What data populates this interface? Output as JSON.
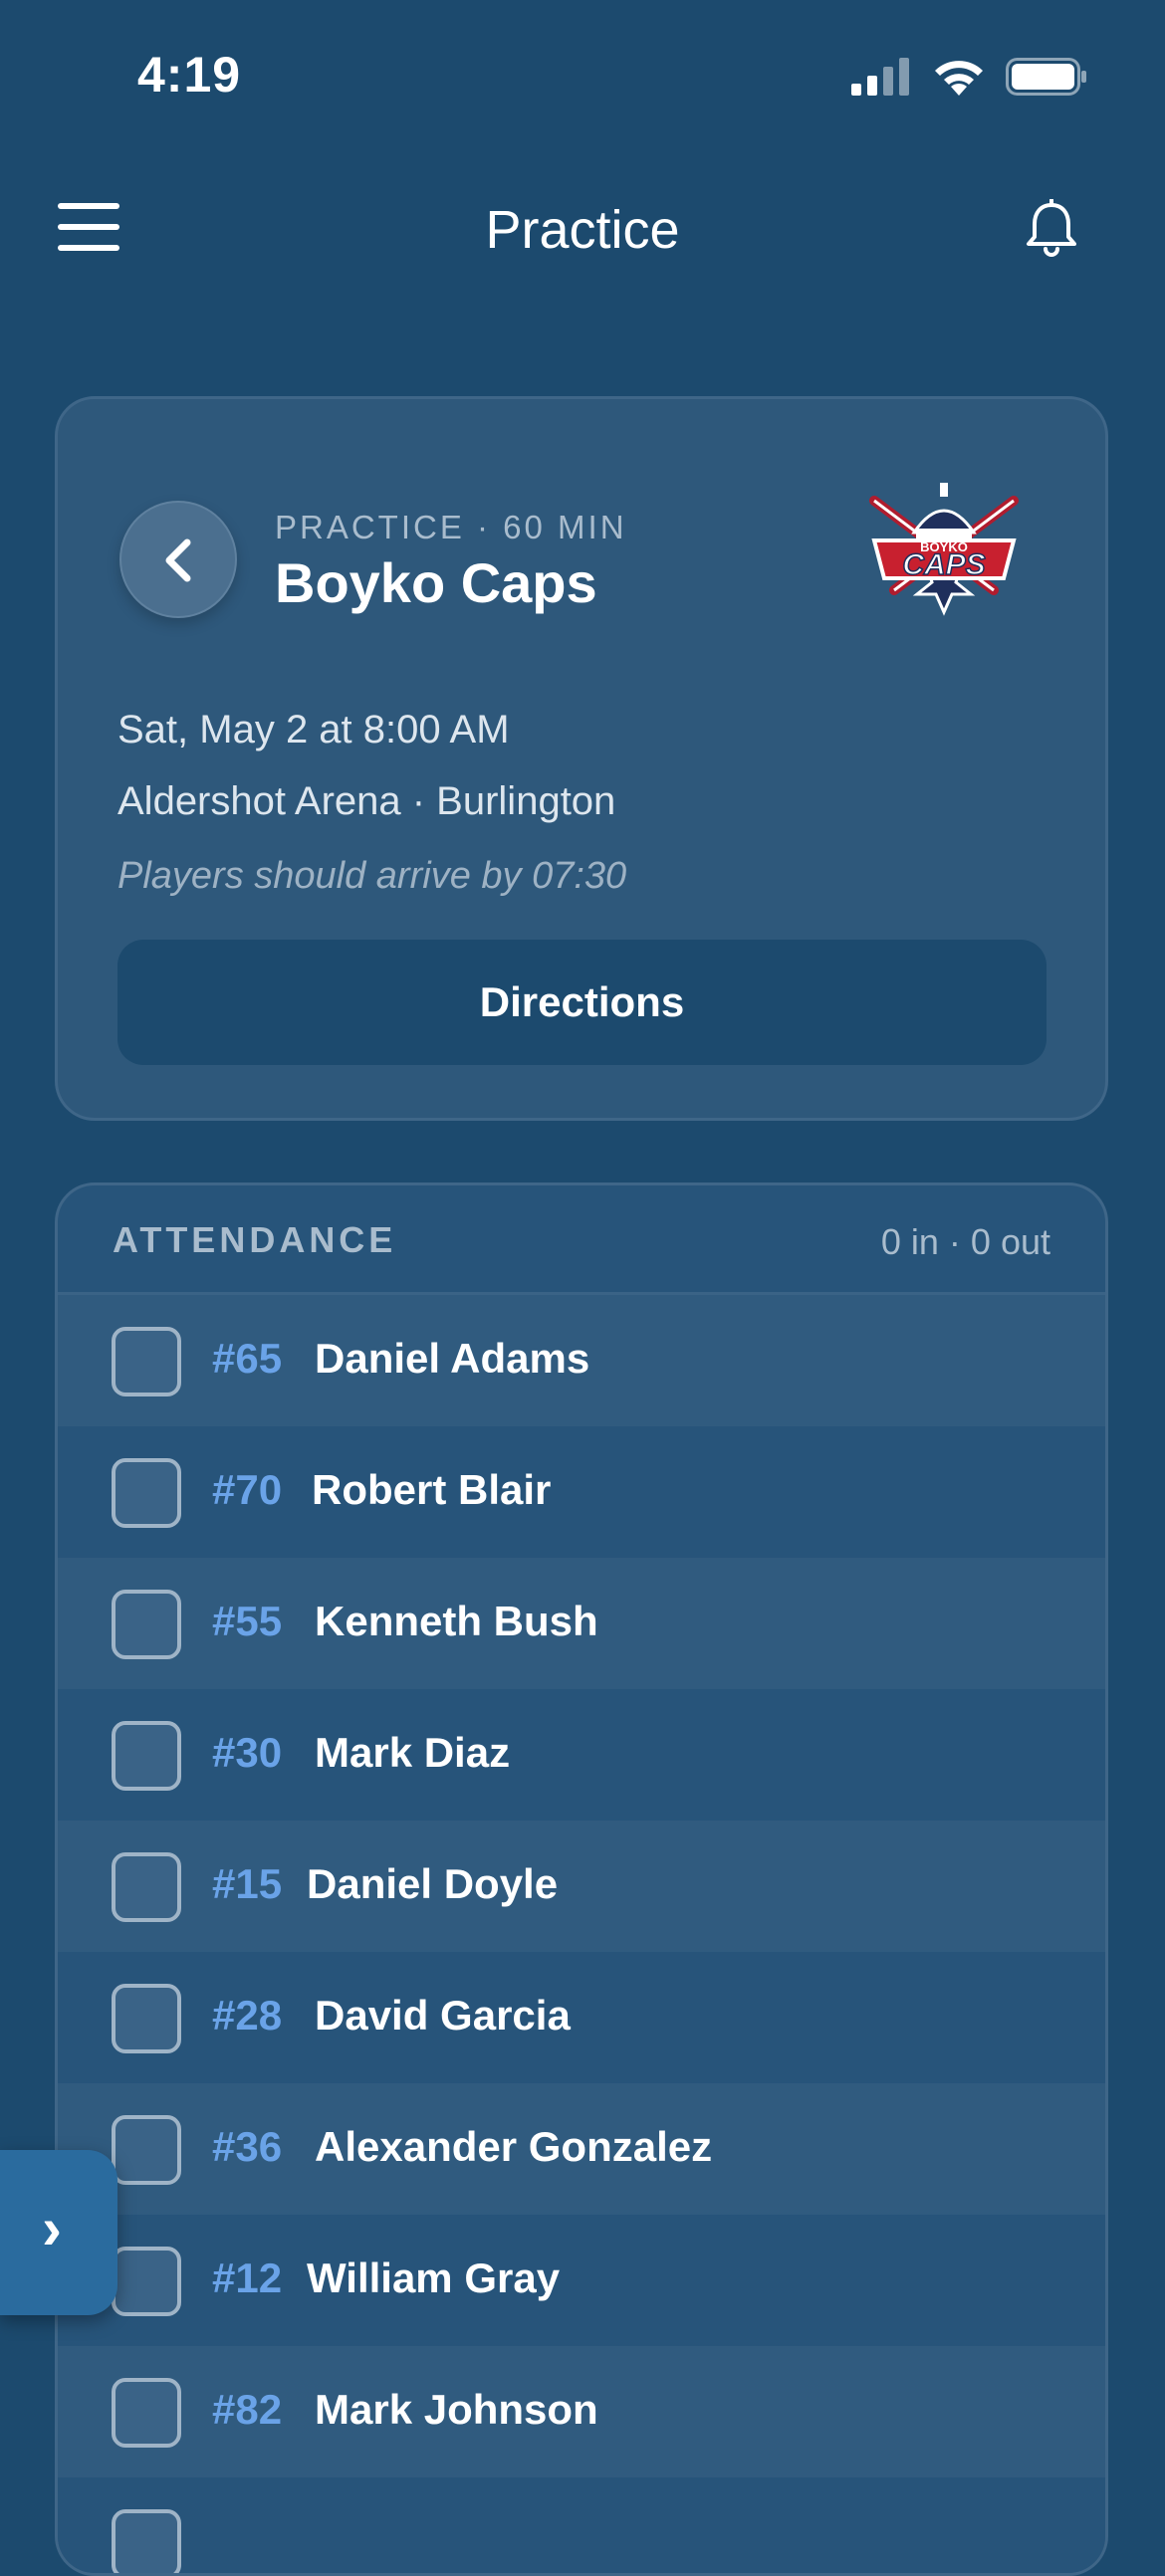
{
  "status_bar": {
    "time": "4:19"
  },
  "nav": {
    "title": "Practice"
  },
  "event": {
    "kicker": "PRACTICE · 60 MIN",
    "team": "Boyko Caps",
    "date": "Sat, May 2 at 8:00 AM",
    "location": "Aldershot Arena · Burlington",
    "arrival_note": "Players should arrive by 07:30",
    "directions_label": "Directions",
    "logo": {
      "top_text": "BOYKO",
      "main_text": "CAPS"
    }
  },
  "attendance": {
    "title": "ATTENDANCE",
    "summary": "0 in · 0 out",
    "players": [
      {
        "number": "#65",
        "name": "Daniel Adams"
      },
      {
        "number": "#70",
        "name": "Robert Blair"
      },
      {
        "number": "#55",
        "name": "Kenneth Bush"
      },
      {
        "number": "#30",
        "name": "Mark Diaz"
      },
      {
        "number": "#15",
        "name": "Daniel Doyle"
      },
      {
        "number": "#28",
        "name": "David Garcia"
      },
      {
        "number": "#36",
        "name": "Alexander Gonzalez"
      },
      {
        "number": "#12",
        "name": "William Gray"
      },
      {
        "number": "#82",
        "name": "Mark Johnson"
      },
      {
        "number": "",
        "name": ""
      }
    ]
  },
  "floating_tab": {
    "label": "›"
  },
  "colors": {
    "background": "#1c4a6e",
    "card": "#2e587b",
    "accent_number": "#6aa3e8",
    "muted_text": "#a9bccd"
  }
}
